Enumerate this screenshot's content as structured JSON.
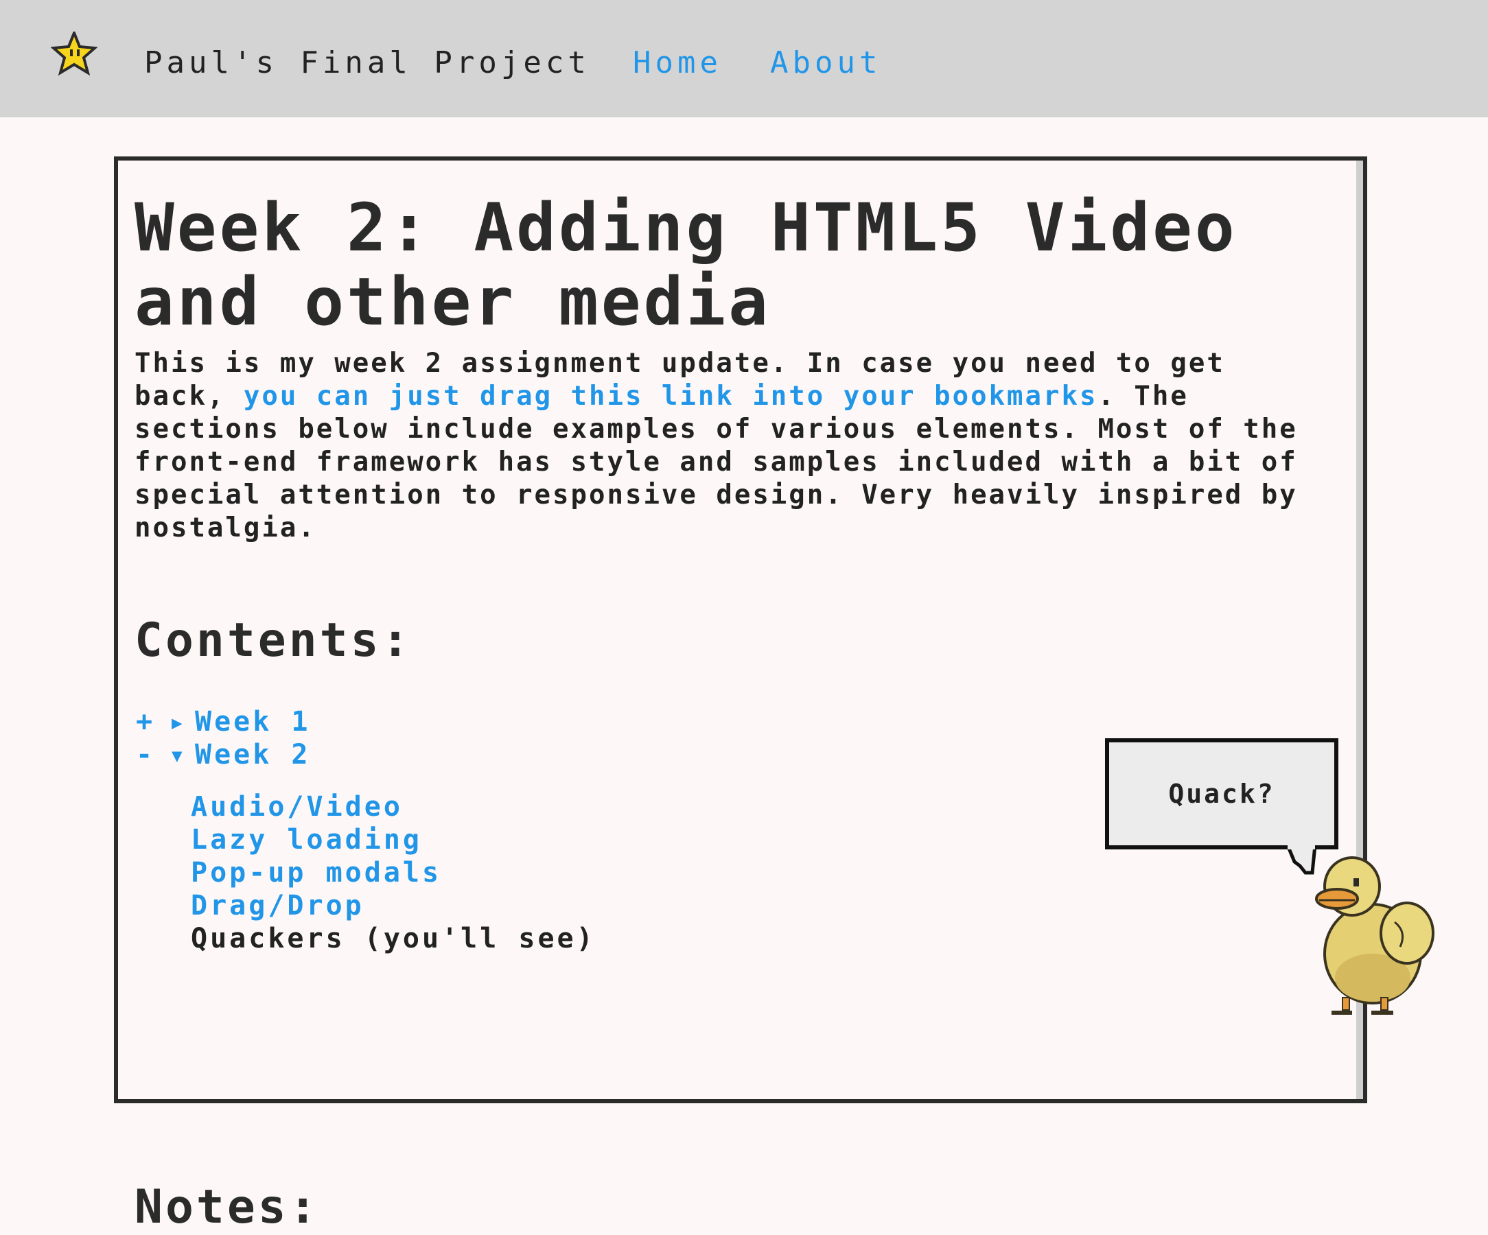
{
  "navbar": {
    "brand": "Paul's Final Project",
    "links": [
      "Home",
      "About"
    ],
    "logo_icon": "star-icon"
  },
  "main": {
    "title": "Week 2: Adding HTML5 Video and other media",
    "intro": {
      "before_link": "This is my week 2 assignment update. In case you need to get back, ",
      "link_text": "you can just drag this link into your bookmarks",
      "after_link": ". The sections below include examples of various elements. Most of the front-end framework has style and samples included with a bit of special attention to responsive design. Very heavily inspired by nostalgia."
    },
    "contents_heading": "Contents:",
    "toc": {
      "week1": {
        "sign": "+",
        "label": "Week 1"
      },
      "week2": {
        "sign": "-",
        "label": "Week 2"
      },
      "week2_items": [
        "Audio/Video",
        "Lazy loading",
        "Pop-up modals",
        "Drag/Drop",
        "Quackers (you'll see)"
      ]
    },
    "notes_heading": "Notes:"
  },
  "mascot": {
    "speech": "Quack?",
    "icon": "duck-icon"
  },
  "colors": {
    "link": "#2196e8",
    "navbar_bg": "#d4d4d4",
    "page_bg": "#fdf8f7",
    "text": "#222222"
  }
}
